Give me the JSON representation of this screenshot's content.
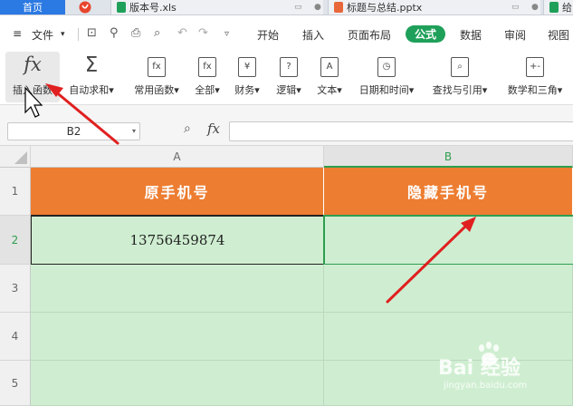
{
  "tabs": {
    "home": "首页",
    "files": [
      {
        "name": "版本号.xls",
        "icon_color": "#1fa05a"
      },
      {
        "name": "标题与总结.pptx",
        "icon_color": "#e8673a"
      },
      {
        "name": "给",
        "icon_color": "#1fa05a"
      }
    ],
    "logo_color": "#e8452c"
  },
  "menu": {
    "file_label": "文件",
    "items": [
      "开始",
      "插入",
      "页面布局",
      "公式",
      "数据",
      "审阅",
      "视图"
    ],
    "active": "公式",
    "active_color": "#1fa05a"
  },
  "ribbon": {
    "insert_function": "插入函数",
    "buttons": [
      "自动求和",
      "常用函数",
      "全部",
      "财务",
      "逻辑",
      "文本",
      "日期和时间",
      "查找与引用",
      "数学和三角"
    ],
    "icon_glyphs": [
      "Σ",
      "fx",
      "fx",
      "¥",
      "?",
      "A",
      "◷",
      "⌕",
      "+-"
    ]
  },
  "formula_bar": {
    "cell_ref": "B2",
    "fx_label": "fx",
    "formula": ""
  },
  "grid": {
    "columns": [
      "A",
      "B"
    ],
    "rows": [
      "1",
      "2",
      "3",
      "4",
      "5"
    ],
    "header_cells": [
      "原手机号",
      "隐藏手机号"
    ],
    "header_color": "#ed7d31",
    "data_cells": [
      "13756459874",
      ""
    ],
    "fill_color": "#cfeed1",
    "selected_cell": "B2"
  },
  "watermark": {
    "text": "Bai 经验",
    "sub": "jingyan.baidu.com"
  }
}
